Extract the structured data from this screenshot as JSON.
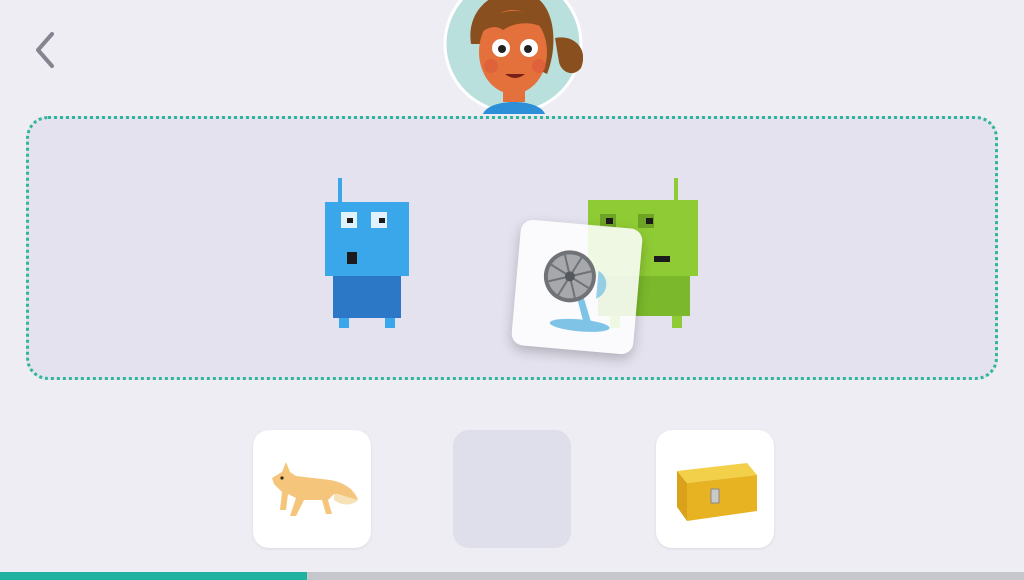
{
  "nav": {
    "back_icon": "chevron-left-icon"
  },
  "avatar": {
    "icon": "girl-avatar"
  },
  "stage": {
    "robots": [
      {
        "name": "blue-robot",
        "color": "#3aa7ea"
      },
      {
        "name": "green-robot",
        "color": "#8fcb35"
      }
    ],
    "dragged_card": {
      "icon": "electric-fan"
    }
  },
  "choices": [
    {
      "icon": "fox"
    },
    {
      "icon": "empty-slot"
    },
    {
      "icon": "treasure-box"
    }
  ],
  "progress": {
    "fraction": 0.3,
    "color": "#1fb2a0"
  }
}
